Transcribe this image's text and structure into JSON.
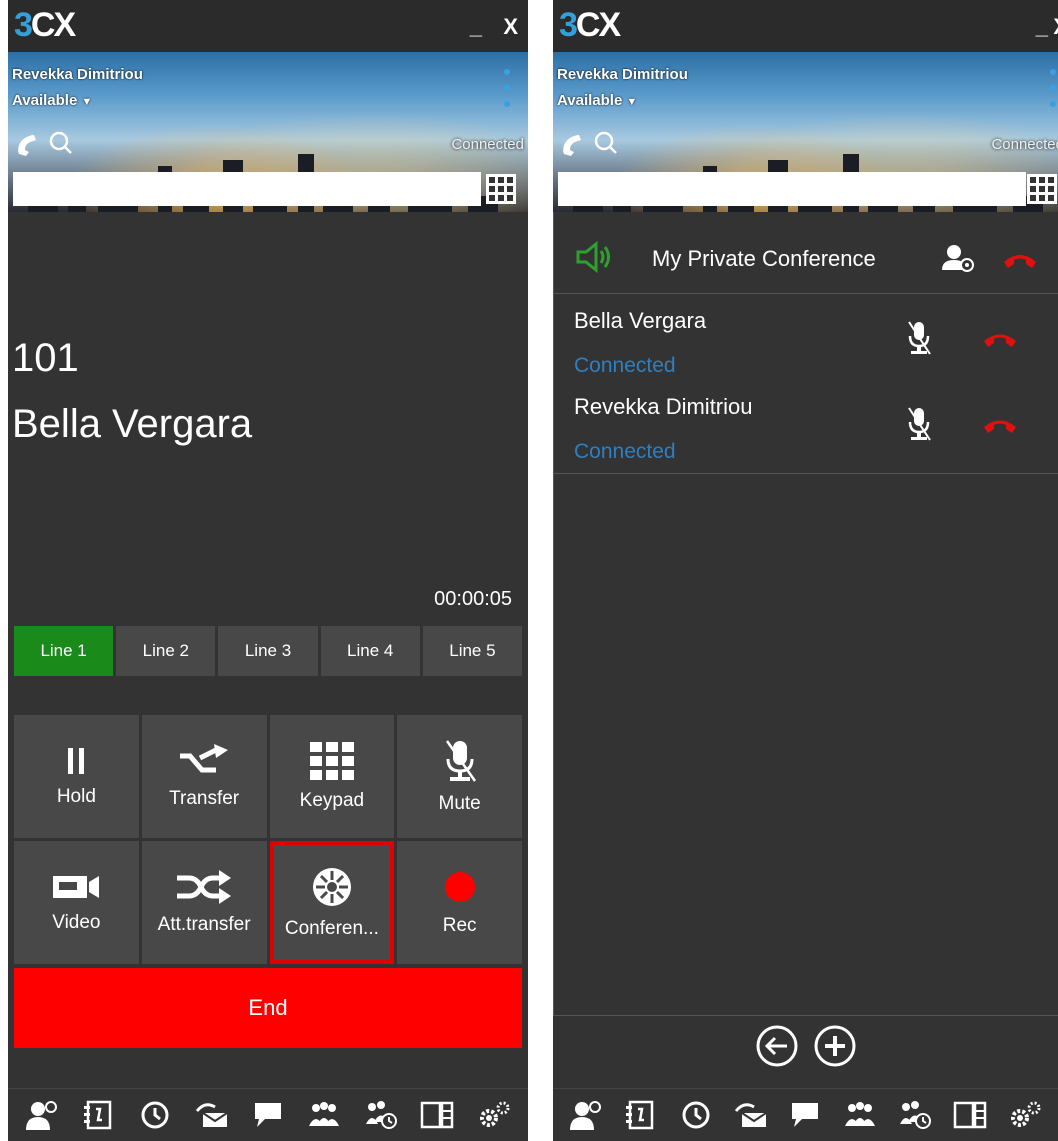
{
  "left_window": {
    "logo_prefix": "3",
    "logo_rest": "CX",
    "minimize_label": "_",
    "close_label": "X",
    "user_name": "Revekka Dimitriou",
    "presence_status": "Available",
    "connection_status": "Connected",
    "dial_input": {
      "value": "",
      "placeholder": ""
    },
    "caller_number": "101",
    "caller_name": "Bella Vergara",
    "call_timer": "00:00:05",
    "lines": [
      {
        "label": "Line 1",
        "active": true
      },
      {
        "label": "Line 2",
        "active": false
      },
      {
        "label": "Line 3",
        "active": false
      },
      {
        "label": "Line 4",
        "active": false
      },
      {
        "label": "Line 5",
        "active": false
      }
    ],
    "actions": {
      "hold": "Hold",
      "transfer": "Transfer",
      "keypad": "Keypad",
      "mute": "Mute",
      "video": "Video",
      "att_transfer": "Att.transfer",
      "conference": "Conferen...",
      "rec": "Rec"
    },
    "end_label": "End"
  },
  "right_window": {
    "logo_prefix": "3",
    "logo_rest": "CX",
    "minimize_label": "_",
    "close_label": "X",
    "user_name": "Revekka Dimitriou",
    "presence_status": "Available",
    "connection_status": "Connected",
    "dial_input": {
      "value": "",
      "placeholder": ""
    },
    "conference_title": "My Private Conference",
    "participants": [
      {
        "name": "Bella Vergara",
        "status": "Connected"
      },
      {
        "name": "Revekka Dimitriou",
        "status": "Connected"
      }
    ]
  },
  "bottom_toolbar_icons": [
    "presence-icon",
    "contacts-icon",
    "recents-icon",
    "voicemail-icon",
    "chat-icon",
    "switchboard-icon",
    "conference-schedule-icon",
    "panels-icon",
    "settings-icon"
  ],
  "colors": {
    "background": "#333333",
    "active_line": "#1a8a1a",
    "end_button": "#ff0000",
    "connected_text": "#2f7fc0",
    "highlight_outline": "#e00000",
    "speaker_green": "#2ea02e",
    "hangup_red": "#e01010"
  }
}
